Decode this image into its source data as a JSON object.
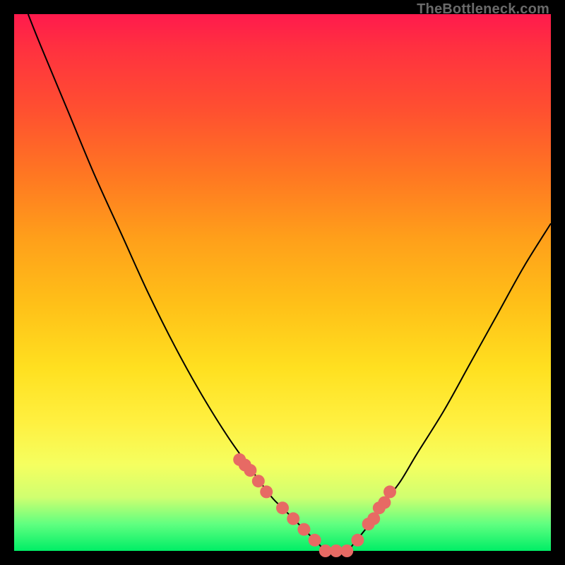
{
  "watermark": "TheBottleneck.com",
  "chart_data": {
    "type": "line",
    "title": "",
    "xlabel": "",
    "ylabel": "",
    "xlim": [
      0,
      100
    ],
    "ylim": [
      0,
      100
    ],
    "grid": false,
    "series": [
      {
        "name": "bottleneck-curve",
        "color": "#000000",
        "x": [
          2.6,
          5,
          10,
          15,
          20,
          25,
          30,
          35,
          40,
          45,
          48,
          50,
          52,
          54,
          56,
          57,
          58,
          60,
          62,
          63,
          67,
          69,
          72,
          75,
          80,
          85,
          90,
          95,
          100
        ],
        "values": [
          100,
          94,
          82,
          70,
          59,
          48,
          38,
          29,
          21,
          14,
          10,
          8,
          6,
          4,
          2,
          1,
          0,
          0,
          0,
          1,
          6,
          9,
          13,
          18,
          26,
          35,
          44,
          53,
          61
        ]
      }
    ],
    "markers": [
      {
        "name": "highlight-points",
        "color": "#e76a64",
        "size": 9,
        "x": [
          42,
          43,
          44,
          45.5,
          47,
          50,
          52,
          54,
          56,
          58,
          60,
          62,
          64,
          66,
          67,
          68,
          69,
          70
        ],
        "values": [
          17,
          16,
          15,
          13,
          11,
          8,
          6,
          4,
          2,
          0,
          0,
          0,
          2,
          5,
          6,
          8,
          9,
          11
        ]
      }
    ]
  }
}
